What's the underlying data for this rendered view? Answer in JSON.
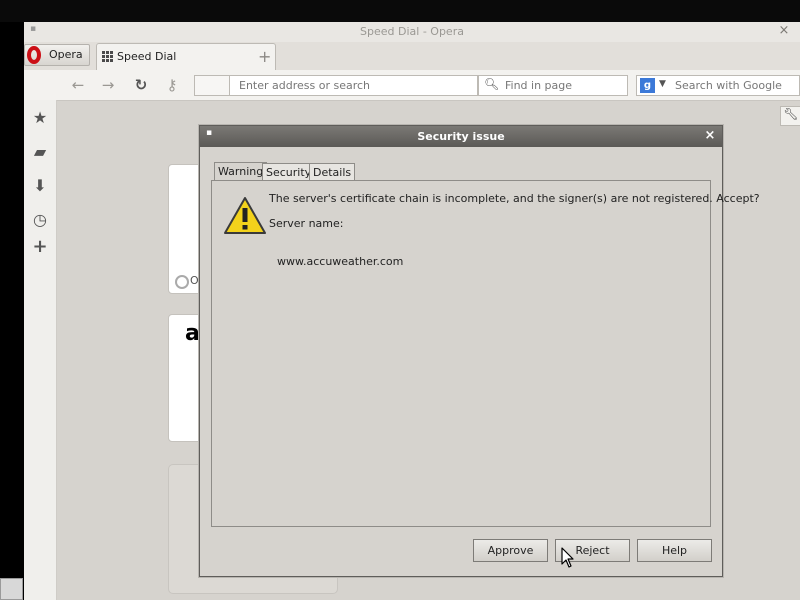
{
  "window": {
    "title": "Speed Dial - Opera",
    "close_glyph": "×"
  },
  "tabbar": {
    "opera_button": "Opera",
    "tabs": [
      {
        "label": "Speed Dial",
        "icon": "speed-dial-grid-icon"
      }
    ],
    "new_tab_glyph": "+"
  },
  "toolbar": {
    "back_glyph": "←",
    "forward_glyph": "→",
    "reload_glyph": "↻",
    "key_glyph": "⚷",
    "address_placeholder": "Enter address or search",
    "find_placeholder": "Find in page",
    "search_engine_glyph": "g",
    "search_placeholder": "Search with Google"
  },
  "sidebar": {
    "items": [
      {
        "name": "bookmarks",
        "glyph": "★"
      },
      {
        "name": "notes",
        "glyph": "▰"
      },
      {
        "name": "downloads",
        "glyph": "⬇"
      },
      {
        "name": "history",
        "glyph": "◷"
      },
      {
        "name": "add",
        "glyph": "+"
      }
    ]
  },
  "speed_dial": {
    "card1_partial_text": "O",
    "card2_partial_text": "a"
  },
  "dialog": {
    "title": "Security issue",
    "close_glyph": "×",
    "tabs": [
      "Warning",
      "Security",
      "Details"
    ],
    "active_tab": "Warning",
    "message": "The server's certificate chain is incomplete, and the signer(s) are not registered. Accept?",
    "server_name_label": "Server name:",
    "server_name": "www.accuweather.com",
    "buttons": {
      "approve": "Approve",
      "reject": "Reject",
      "help": "Help"
    }
  },
  "colors": {
    "warning_yellow": "#f3d21b",
    "opera_red": "#cc0f16",
    "google_blue": "#3c79d8"
  }
}
